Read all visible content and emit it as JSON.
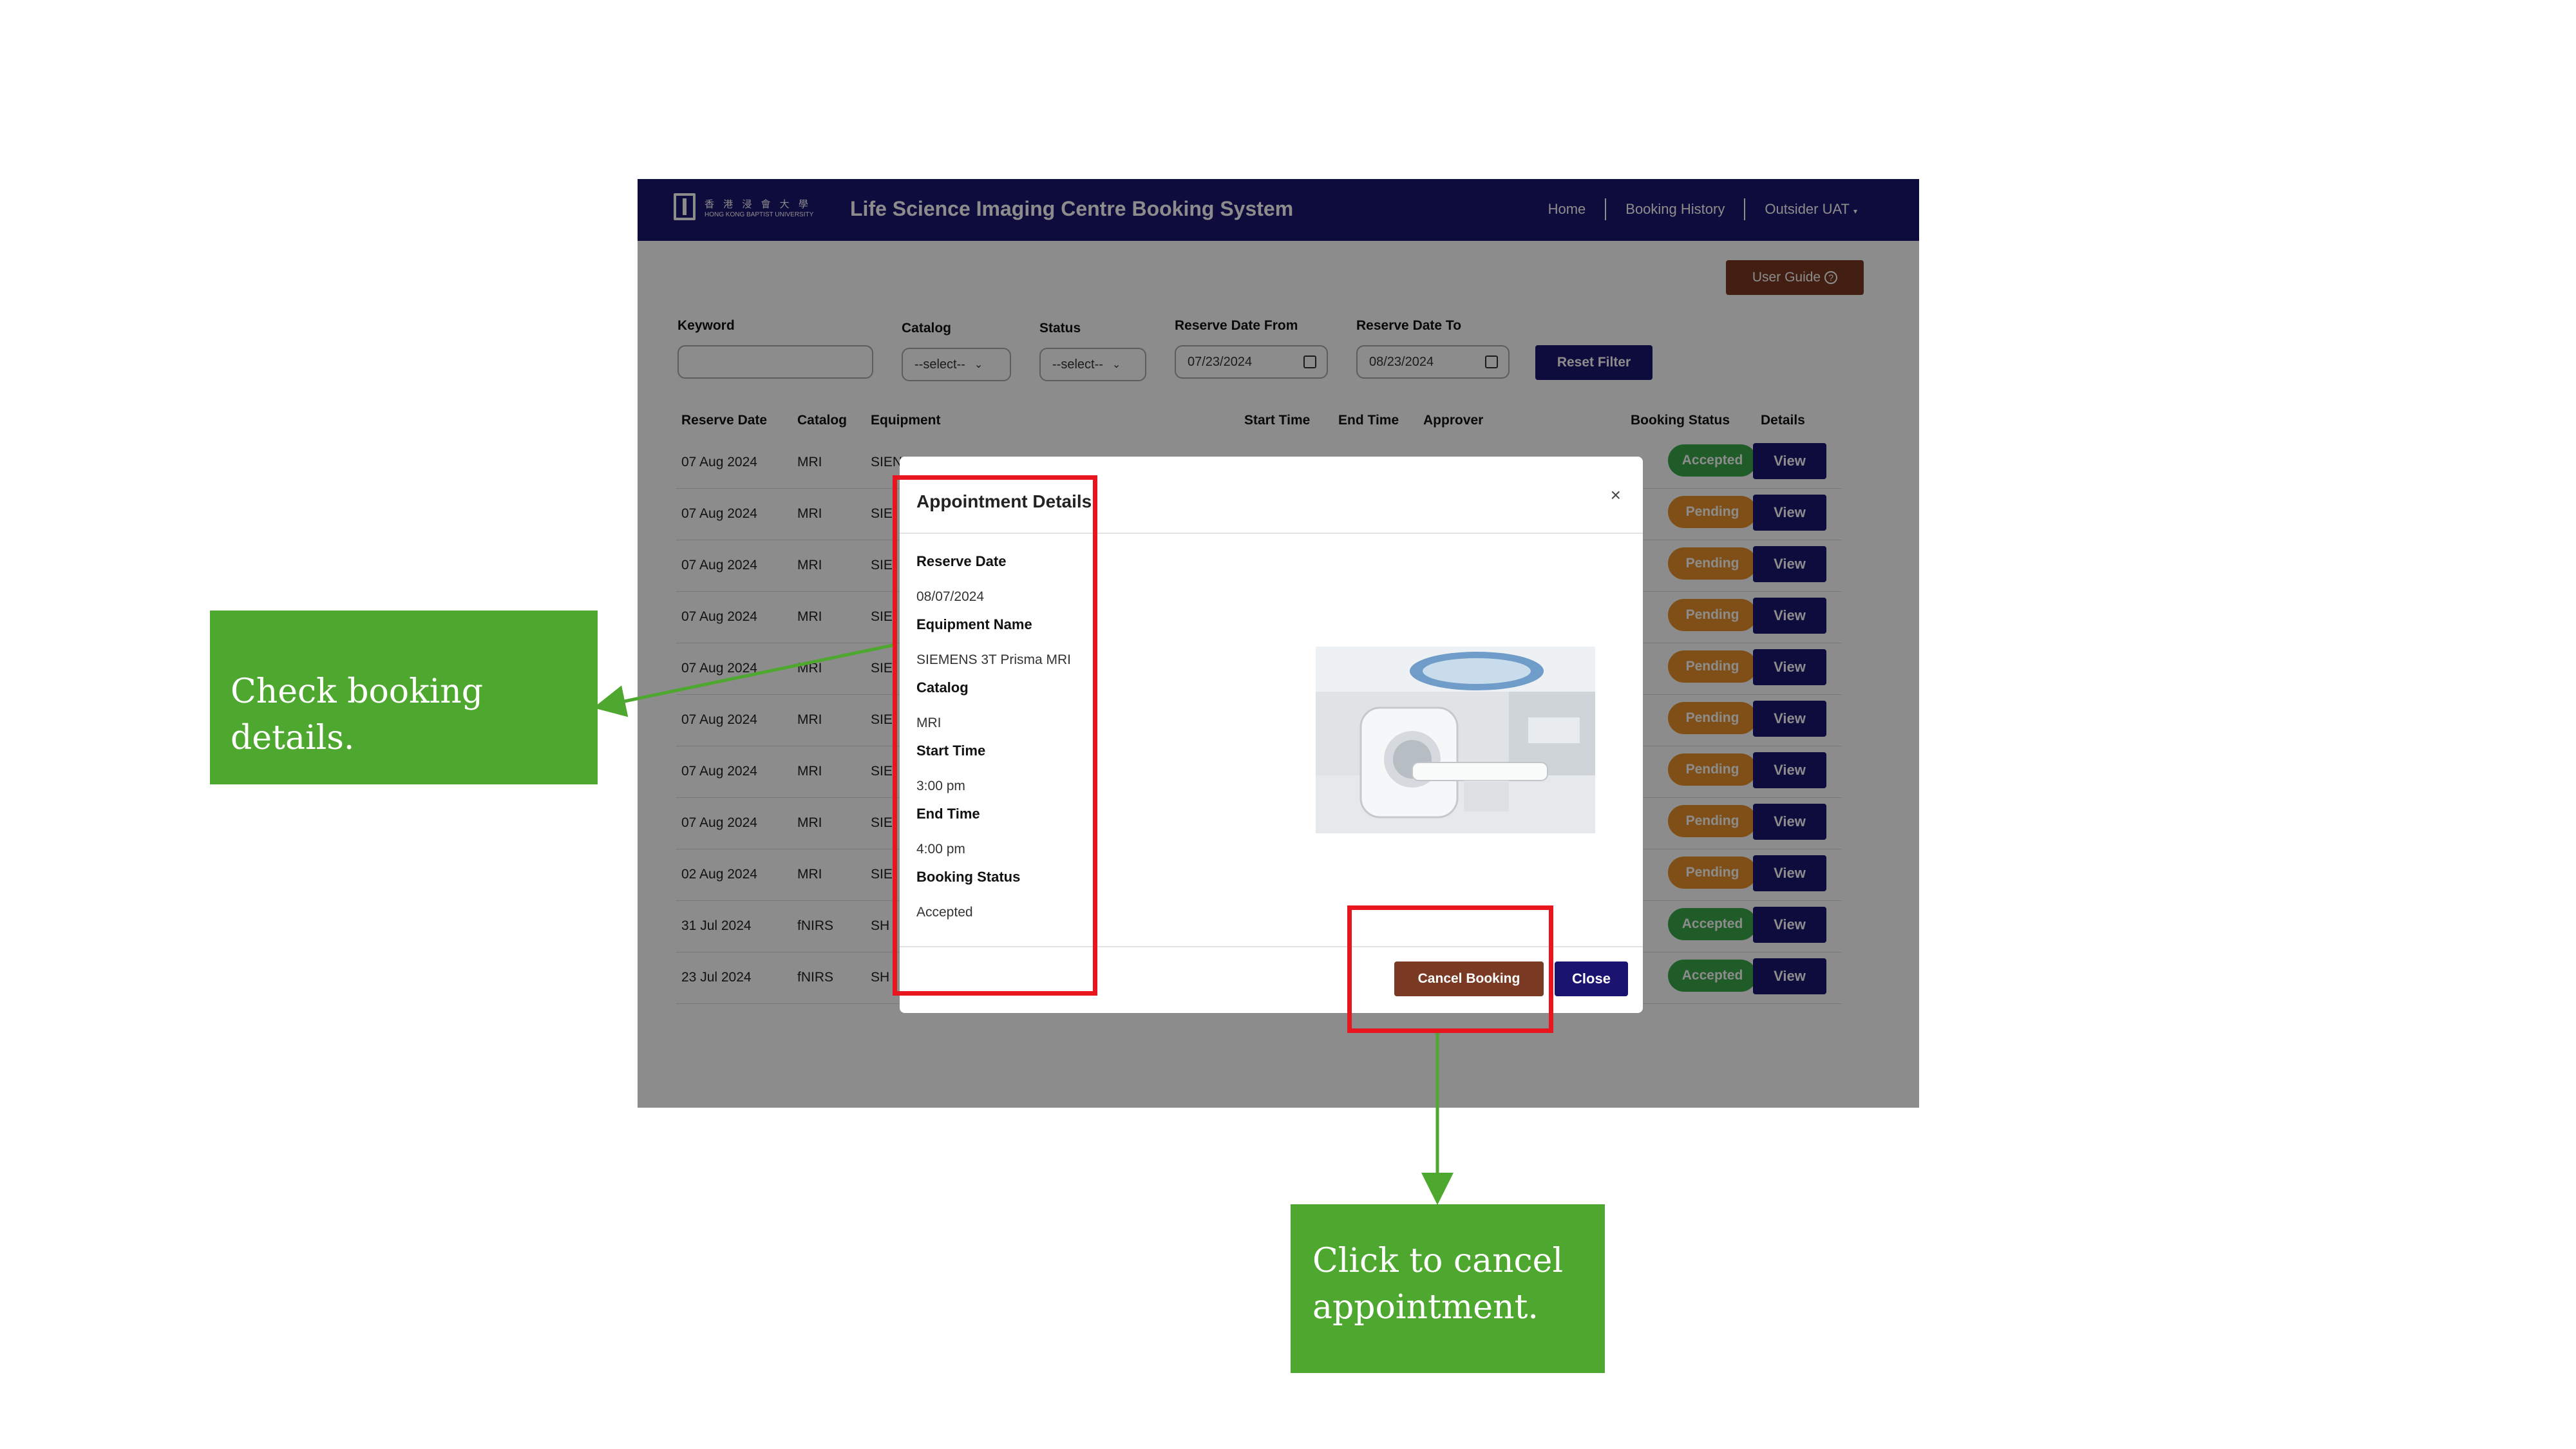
{
  "header": {
    "university_cn": "香 港 浸 會 大 學",
    "university_en": "HONG KONG BAPTIST UNIVERSITY",
    "title": "Life Science Imaging Centre Booking System",
    "nav": [
      "Home",
      "Booking History",
      "Outsider UAT"
    ]
  },
  "user_guide_label": "User Guide",
  "filters": {
    "keyword_label": "Keyword",
    "catalog_label": "Catalog",
    "catalog_value": "--select--",
    "status_label": "Status",
    "status_value": "--select--",
    "from_label": "Reserve Date From",
    "from_value": "07/23/2024",
    "to_label": "Reserve Date To",
    "to_value": "08/23/2024",
    "reset_label": "Reset Filter"
  },
  "table": {
    "headers": [
      "Reserve Date",
      "Catalog",
      "Equipment",
      "Start Time",
      "End Time",
      "Approver",
      "Booking Status",
      "Details"
    ],
    "rows": [
      {
        "date": "07 Aug 2024",
        "catalog": "MRI",
        "equipment": "SIEN",
        "status": "Accepted"
      },
      {
        "date": "07 Aug 2024",
        "catalog": "MRI",
        "equipment": "SIE",
        "status": "Pending"
      },
      {
        "date": "07 Aug 2024",
        "catalog": "MRI",
        "equipment": "SIE",
        "status": "Pending"
      },
      {
        "date": "07 Aug 2024",
        "catalog": "MRI",
        "equipment": "SIE",
        "status": "Pending"
      },
      {
        "date": "07 Aug 2024",
        "catalog": "MRI",
        "equipment": "SIE",
        "status": "Pending"
      },
      {
        "date": "07 Aug 2024",
        "catalog": "MRI",
        "equipment": "SIE",
        "status": "Pending"
      },
      {
        "date": "07 Aug 2024",
        "catalog": "MRI",
        "equipment": "SIE",
        "status": "Pending"
      },
      {
        "date": "07 Aug 2024",
        "catalog": "MRI",
        "equipment": "SIE",
        "status": "Pending"
      },
      {
        "date": "02 Aug 2024",
        "catalog": "MRI",
        "equipment": "SIE",
        "status": "Pending"
      },
      {
        "date": "31 Jul 2024",
        "catalog": "fNIRS",
        "equipment": "SH",
        "status": "Accepted"
      },
      {
        "date": "23 Jul 2024",
        "catalog": "fNIRS",
        "equipment": "SH",
        "status": "Accepted"
      }
    ],
    "view_label": "View"
  },
  "modal": {
    "title": "Appointment Details",
    "close_x": "×",
    "fields": [
      {
        "label": "Reserve Date",
        "value": "08/07/2024"
      },
      {
        "label": "Equipment Name",
        "value": "SIEMENS 3T Prisma MRI"
      },
      {
        "label": "Catalog",
        "value": "MRI"
      },
      {
        "label": "Start Time",
        "value": "3:00 pm"
      },
      {
        "label": "End Time",
        "value": "4:00 pm"
      },
      {
        "label": "Booking Status",
        "value": "Accepted"
      }
    ],
    "cancel_label": "Cancel Booking",
    "close_label": "Close"
  },
  "callouts": {
    "details": "Check booking details.",
    "cancel_line1": "Click to cancel",
    "cancel_line2": "appointment."
  },
  "colors": {
    "navy": "#1a1470",
    "brown": "#7a3a24",
    "accepted": "#3aa84a",
    "pending": "#e8902a",
    "highlight": "#e8141e",
    "callout_green": "#4ea72e"
  },
  "icons": [
    "university-logo-icon",
    "question-circle-icon",
    "chevron-down-icon",
    "calendar-icon",
    "close-icon"
  ]
}
